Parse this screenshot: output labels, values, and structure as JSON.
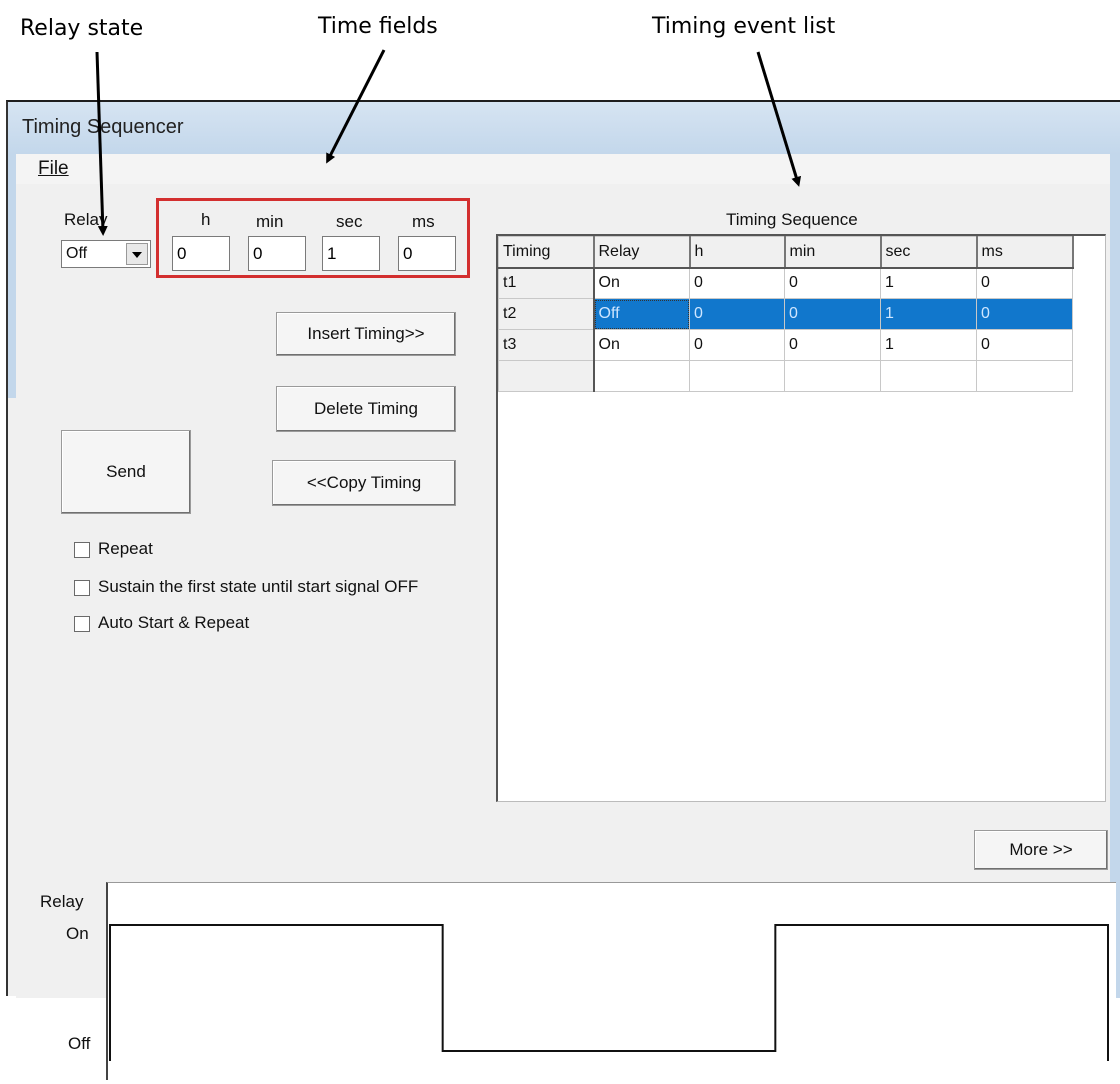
{
  "callouts": {
    "relay_state": "Relay state",
    "time_fields": "Time fields",
    "timing_event_list": "Timing event list"
  },
  "window": {
    "title": "Timing Sequencer"
  },
  "menu": {
    "file": "File"
  },
  "controls": {
    "relay_label": "Relay",
    "relay_value": "Off",
    "h_label": "h",
    "min_label": "min",
    "sec_label": "sec",
    "ms_label": "ms",
    "h_value": "0",
    "min_value": "0",
    "sec_value": "1",
    "ms_value": "0"
  },
  "buttons": {
    "insert": "Insert Timing>>",
    "delete": "Delete Timing",
    "copy": "<<Copy Timing",
    "send": "Send",
    "more": "More >>"
  },
  "options": {
    "repeat": "Repeat",
    "sustain": "Sustain the first state until start signal OFF",
    "auto": "Auto Start & Repeat"
  },
  "sequence": {
    "title": "Timing Sequence",
    "columns": [
      "Timing",
      "Relay",
      "h",
      "min",
      "sec",
      "ms"
    ],
    "rows": [
      {
        "timing": "t1",
        "relay": "On",
        "h": "0",
        "min": "0",
        "sec": "1",
        "ms": "0"
      },
      {
        "timing": "t2",
        "relay": "Off",
        "h": "0",
        "min": "0",
        "sec": "1",
        "ms": "0"
      },
      {
        "timing": "t3",
        "relay": "On",
        "h": "0",
        "min": "0",
        "sec": "1",
        "ms": "0"
      }
    ],
    "selected_row": "t2"
  },
  "waveform": {
    "y_label": "Relay",
    "on_label": "On",
    "off_label": "Off",
    "states": [
      "On",
      "Off",
      "On"
    ]
  }
}
